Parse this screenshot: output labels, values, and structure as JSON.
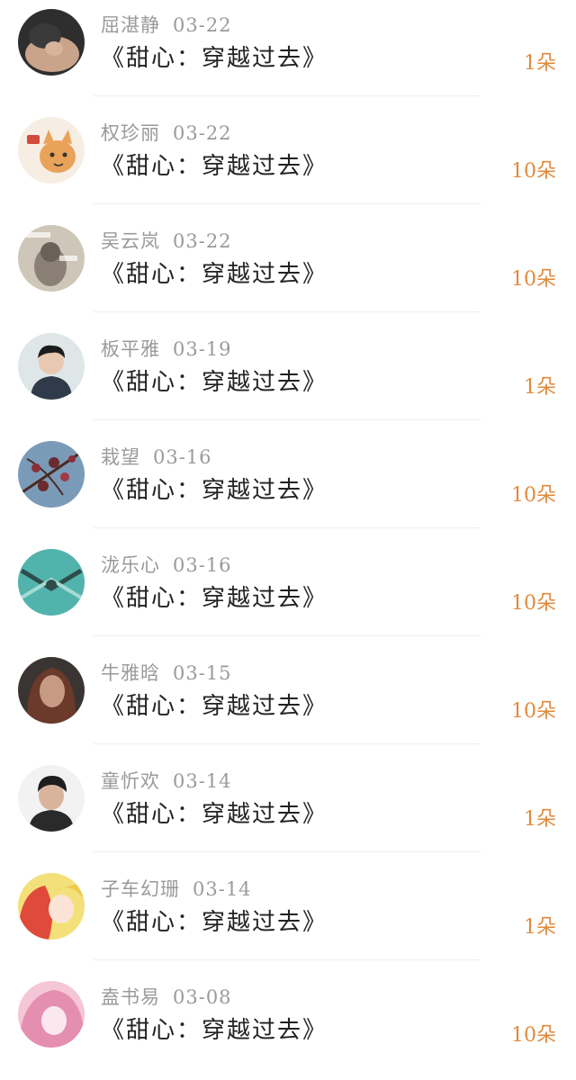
{
  "colors": {
    "name_date": "#9a9a9a",
    "title": "#222222",
    "count": "#e08a3c",
    "divider": "#eeeeee"
  },
  "rows": [
    {
      "name": "屈湛静",
      "date": "03-22",
      "title": "《甜心：穿越过去》",
      "count": "1朵",
      "avatar": {
        "icon": "person-sleeping-avatar",
        "c1": "#3a3a3a",
        "c2": "#c9a48a"
      }
    },
    {
      "name": "权珍丽",
      "date": "03-22",
      "title": "《甜心：穿越过去》",
      "count": "10朵",
      "avatar": {
        "icon": "cartoon-cat-avatar",
        "c1": "#f6ede3",
        "c2": "#e8a25a"
      }
    },
    {
      "name": "吴云岚",
      "date": "03-22",
      "title": "《甜心：穿越过去》",
      "count": "10朵",
      "avatar": {
        "icon": "photo-avatar",
        "c1": "#8a8075",
        "c2": "#cfc6ba"
      }
    },
    {
      "name": "板平雅",
      "date": "03-19",
      "title": "《甜心：穿越过去》",
      "count": "1朵",
      "avatar": {
        "icon": "young-man-avatar",
        "c1": "#dfe6e8",
        "c2": "#2f3b4a"
      }
    },
    {
      "name": "栽望",
      "date": "03-16",
      "title": "《甜心：穿越过去》",
      "count": "10朵",
      "avatar": {
        "icon": "blossom-branch-avatar",
        "c1": "#7a9bb8",
        "c2": "#6b2a2e"
      }
    },
    {
      "name": "泷乐心",
      "date": "03-16",
      "title": "《甜心：穿越过去》",
      "count": "10朵",
      "avatar": {
        "icon": "teal-pattern-avatar",
        "c1": "#52b3ad",
        "c2": "#a4dcd2"
      }
    },
    {
      "name": "牛雅晗",
      "date": "03-15",
      "title": "《甜心：穿越过去》",
      "count": "10朵",
      "avatar": {
        "icon": "woman-portrait-avatar",
        "c1": "#3a3532",
        "c2": "#c79a84"
      }
    },
    {
      "name": "童忻欢",
      "date": "03-14",
      "title": "《甜心：穿越过去》",
      "count": "1朵",
      "avatar": {
        "icon": "man-portrait-avatar",
        "c1": "#f2f2f2",
        "c2": "#2a2a2a"
      }
    },
    {
      "name": "子车幻珊",
      "date": "03-14",
      "title": "《甜心：穿越过去》",
      "count": "1朵",
      "avatar": {
        "icon": "anime-girl-avatar",
        "c1": "#f4e07a",
        "c2": "#e04a3a"
      }
    },
    {
      "name": "盍书易",
      "date": "03-08",
      "title": "《甜心：穿越过去》",
      "count": "10朵",
      "avatar": {
        "icon": "anime-pink-avatar",
        "c1": "#f4c6d6",
        "c2": "#e58fb0"
      }
    }
  ]
}
